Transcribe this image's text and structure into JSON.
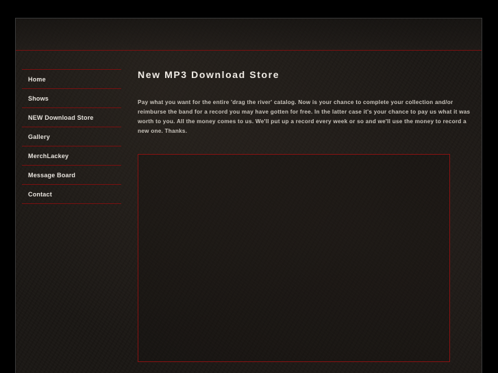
{
  "nav": {
    "items": [
      {
        "label": "Home"
      },
      {
        "label": "Shows"
      },
      {
        "label": "NEW Download Store"
      },
      {
        "label": "Gallery"
      },
      {
        "label": "MerchLackey"
      },
      {
        "label": "Message Board"
      },
      {
        "label": "Contact"
      }
    ]
  },
  "main": {
    "title": "New MP3 Download Store",
    "paragraph": "Pay what you want for the entire 'drag the river' catalog. Now is your chance to complete your collection and/or reimburse the band for a record you may have gotten for free. In the latter case it's your chance to pay us what it was worth to you. All the money comes to us. We'll put up a record every week or so and we'll use the money to record a new one. Thanks."
  },
  "colors": {
    "background": "#000000",
    "panel": "#1c1916",
    "accent_line": "#7a1010",
    "heading_text": "#f0ece6",
    "body_text": "#c9c4bc"
  }
}
